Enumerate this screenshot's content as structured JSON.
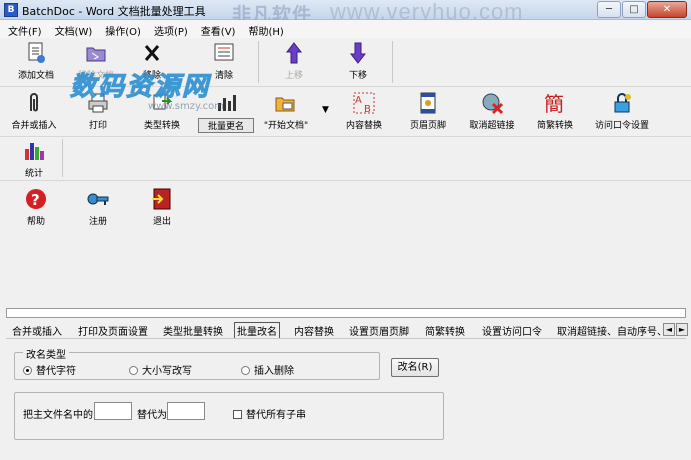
{
  "window": {
    "title": "BatchDoc - Word 文档批量处理工具",
    "watermark_top_cn": "非凡软件",
    "watermark_top_url": "www.veryhuo.com",
    "minimize": "─",
    "restore": "□",
    "close": "✕"
  },
  "menu": [
    "文件(F)",
    "文档(W)",
    "操作(O)",
    "选项(P)",
    "查看(V)",
    "帮助(H)"
  ],
  "watermark_mid": "数码资源网",
  "watermark_mid_url": "www.smzy.com",
  "toolbar_row1": {
    "add_doc": "添加文档",
    "remove_doc": "移除文档",
    "move": "移除",
    "clear": "清除",
    "up": "上移",
    "down": "下移"
  },
  "toolbar_row2": {
    "merge_insert": "合并或插入",
    "print": "打印",
    "type_convert": "类型转换",
    "batch_rename": "批量更名",
    "start_doc": "\"开始文档\"",
    "content_replace": "内容替换",
    "header_footer": "页眉页脚",
    "remove_hyperlink": "取消超链接",
    "trad_simp": "简繁转换",
    "access_password": "访问口令设置"
  },
  "toolbar_row3": {
    "stats": "统计"
  },
  "toolbar_row4": {
    "help": "帮助",
    "register": "注册",
    "exit": "退出"
  },
  "tabs": [
    "合并或插入",
    "打印及页面设置",
    "类型批量转换",
    "批量改名",
    "内容替换",
    "设置页眉页脚",
    "简繁转换",
    "设置访问口令",
    "取消超链接、自动序号、"
  ],
  "active_tab": "批量改名",
  "tab_scroll_left": "◄",
  "tab_scroll_right": "►",
  "rename": {
    "group_title": "改名类型",
    "options": [
      "替代字符",
      "大小写改写",
      "插入删除"
    ],
    "selected": "替代字符",
    "rename_button": "改名(R)",
    "prefix_label": "把主文件名中的",
    "replace_with_label": "替代为",
    "find_value": "",
    "replace_value": "",
    "replace_all_label": "替代所有子串",
    "replace_all_checked": false
  }
}
